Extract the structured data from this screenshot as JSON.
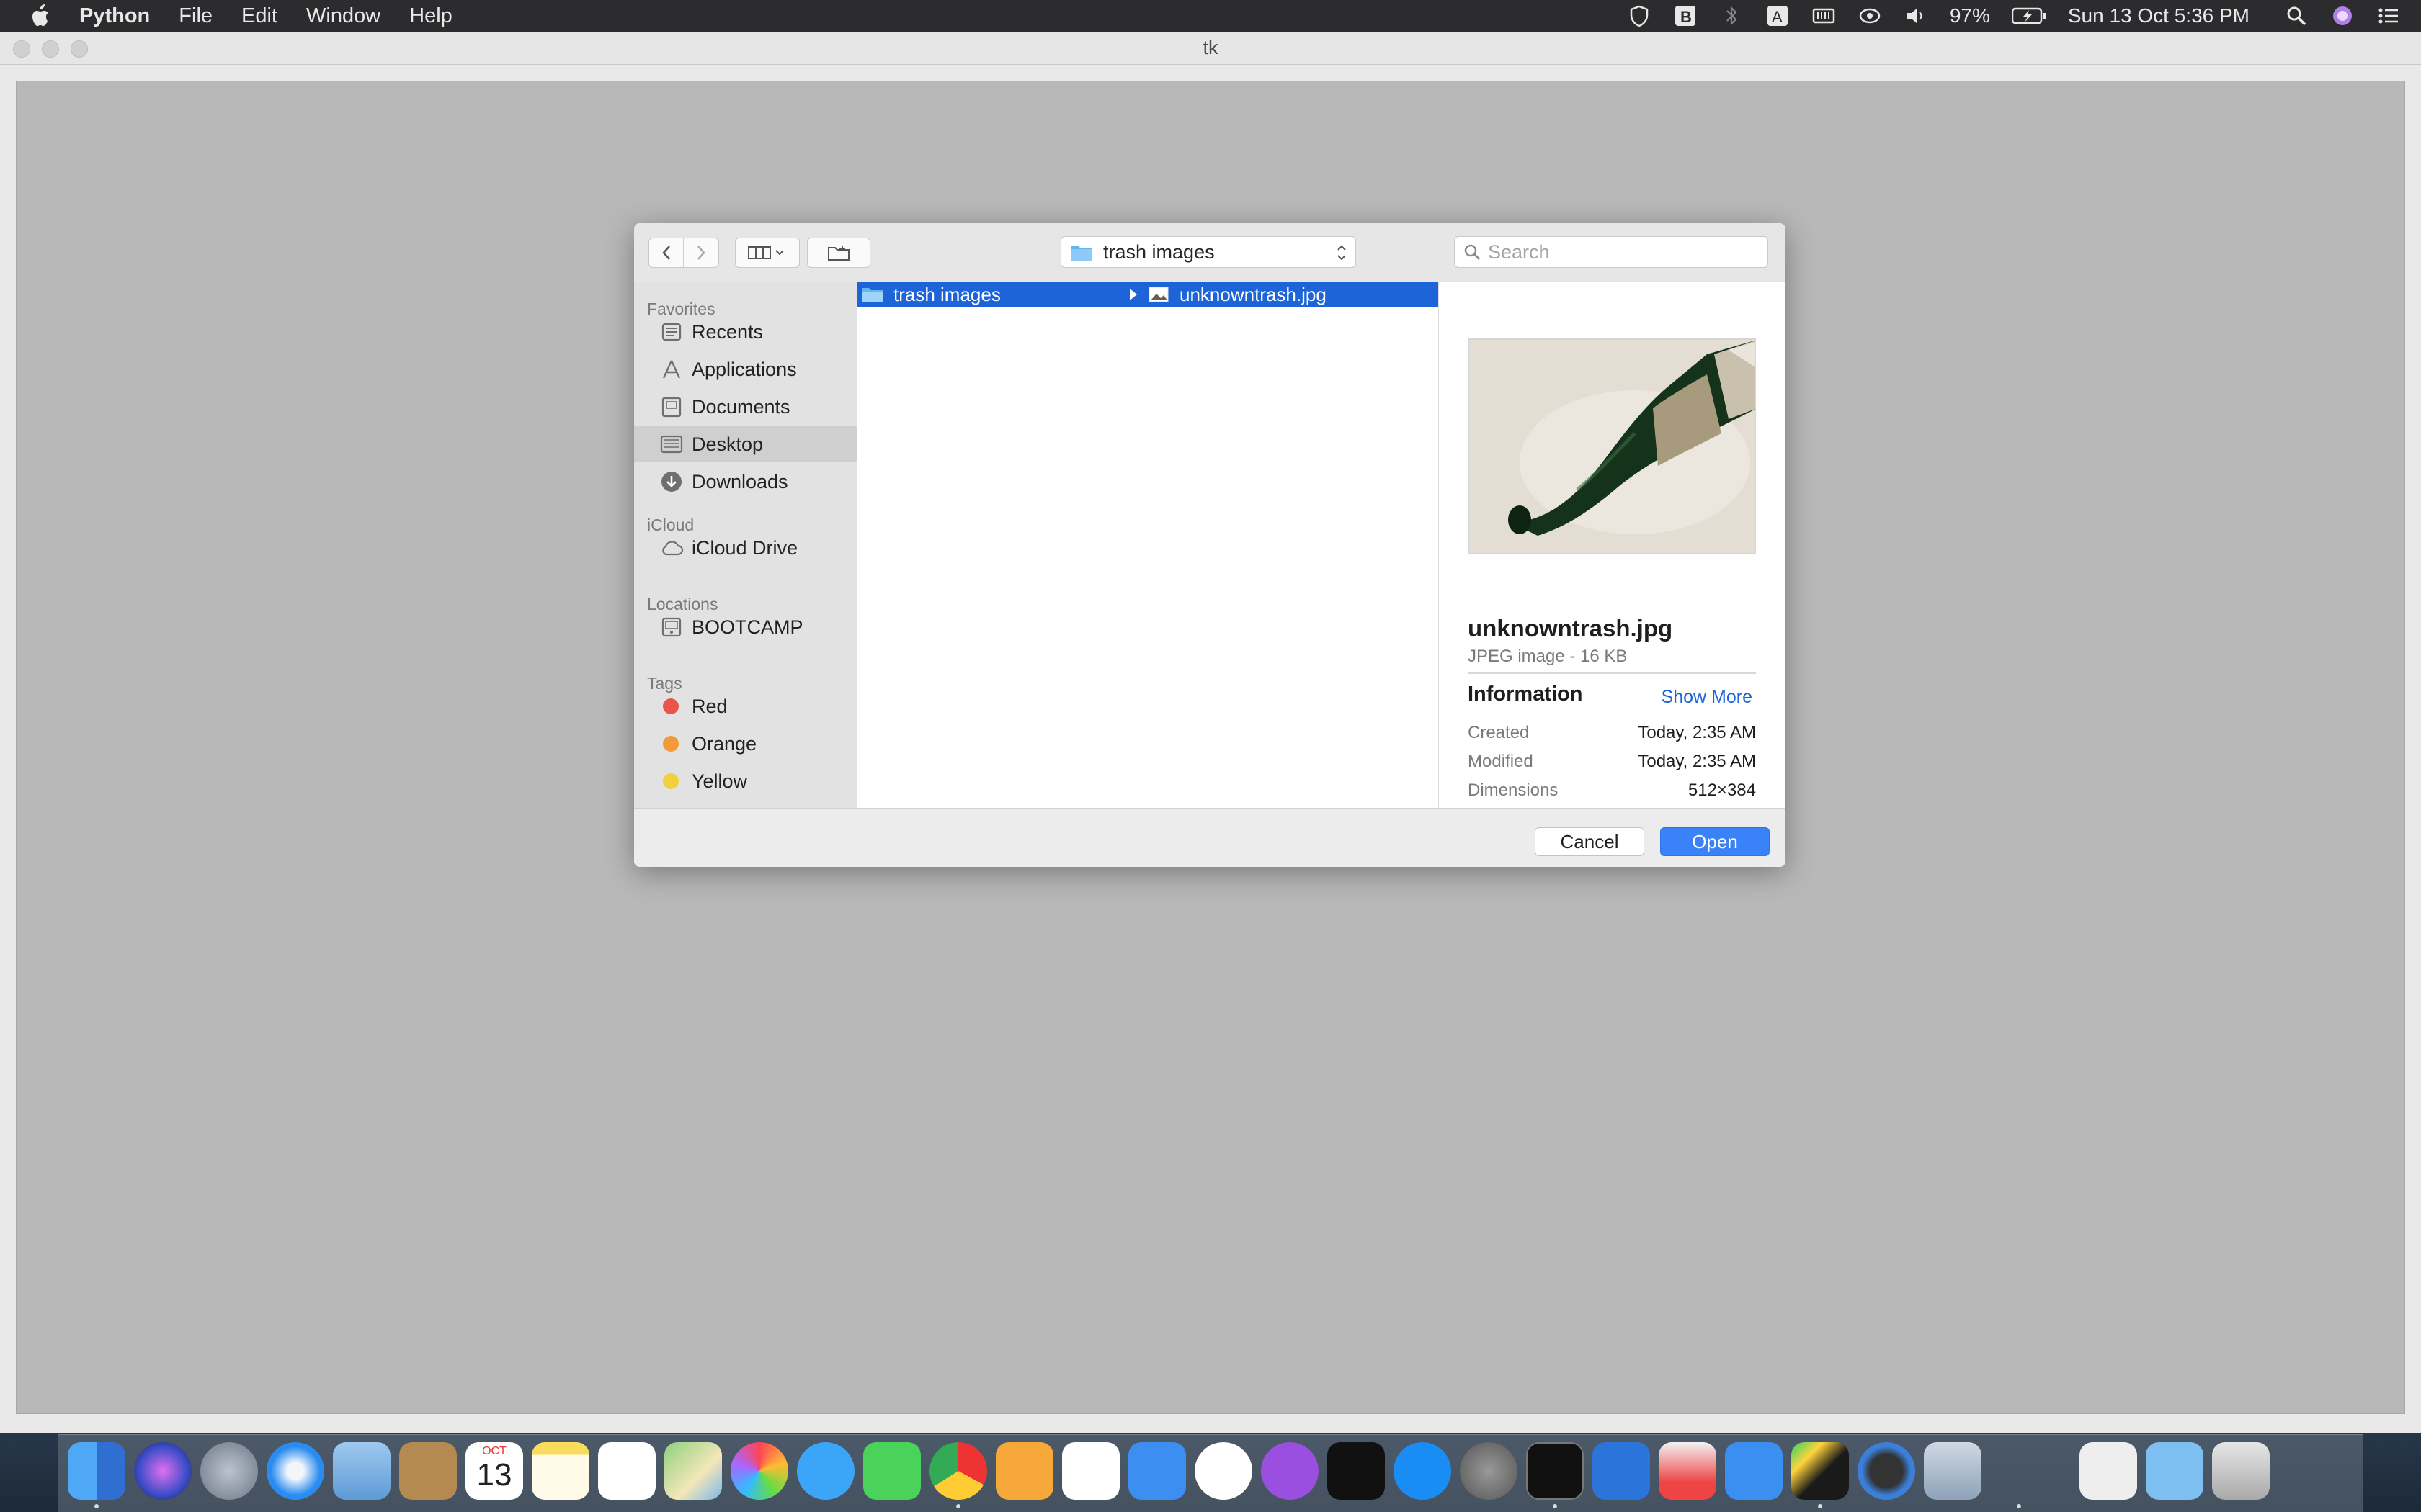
{
  "menubar": {
    "app_name": "Python",
    "items": [
      "File",
      "Edit",
      "Window",
      "Help"
    ],
    "battery": "97%",
    "clock": "Sun 13 Oct  5:36 PM"
  },
  "window": {
    "title": "tk"
  },
  "dialog": {
    "location": "trash images",
    "search_placeholder": "Search",
    "sidebar": {
      "favorites_header": "Favorites",
      "favorites": [
        "Recents",
        "Applications",
        "Documents",
        "Desktop",
        "Downloads"
      ],
      "icloud_header": "iCloud",
      "icloud": [
        "iCloud Drive"
      ],
      "locations_header": "Locations",
      "locations": [
        "BOOTCAMP"
      ],
      "tags_header": "Tags",
      "tags": [
        {
          "label": "Red",
          "color": "#e9544b"
        },
        {
          "label": "Orange",
          "color": "#f29a38"
        },
        {
          "label": "Yellow",
          "color": "#f2cf3c"
        }
      ],
      "selected": "Desktop"
    },
    "column1": {
      "selected_item": "trash images"
    },
    "column2": {
      "selected_item": "unknowntrash.jpg"
    },
    "preview": {
      "filename": "unknowntrash.jpg",
      "kind": "JPEG image - 16 KB",
      "info_header": "Information",
      "show_more": "Show More",
      "rows": [
        {
          "key": "Created",
          "value": "Today, 2:35 AM"
        },
        {
          "key": "Modified",
          "value": "Today, 2:35 AM"
        },
        {
          "key": "Dimensions",
          "value": "512×384"
        }
      ]
    },
    "buttons": {
      "cancel": "Cancel",
      "open": "Open"
    }
  },
  "dock": {
    "apps": [
      "Finder",
      "Siri",
      "Launchpad",
      "Safari",
      "Mail",
      "Contacts",
      "Calendar",
      "Notes",
      "Reminders",
      "Maps",
      "Photos",
      "Messages",
      "FaceTime",
      "Chrome",
      "Pages",
      "Numbers",
      "Keynote",
      "Music",
      "Podcasts",
      "TV",
      "App Store",
      "System Preferences",
      "Terminal",
      "Xcode",
      "Popcorn",
      "Dropbox",
      "PyCharm",
      "QuickTime",
      "Preview",
      "Rocket",
      "Archive",
      "Folder",
      "Trash"
    ],
    "calendar_month": "OCT",
    "calendar_day": "13"
  }
}
